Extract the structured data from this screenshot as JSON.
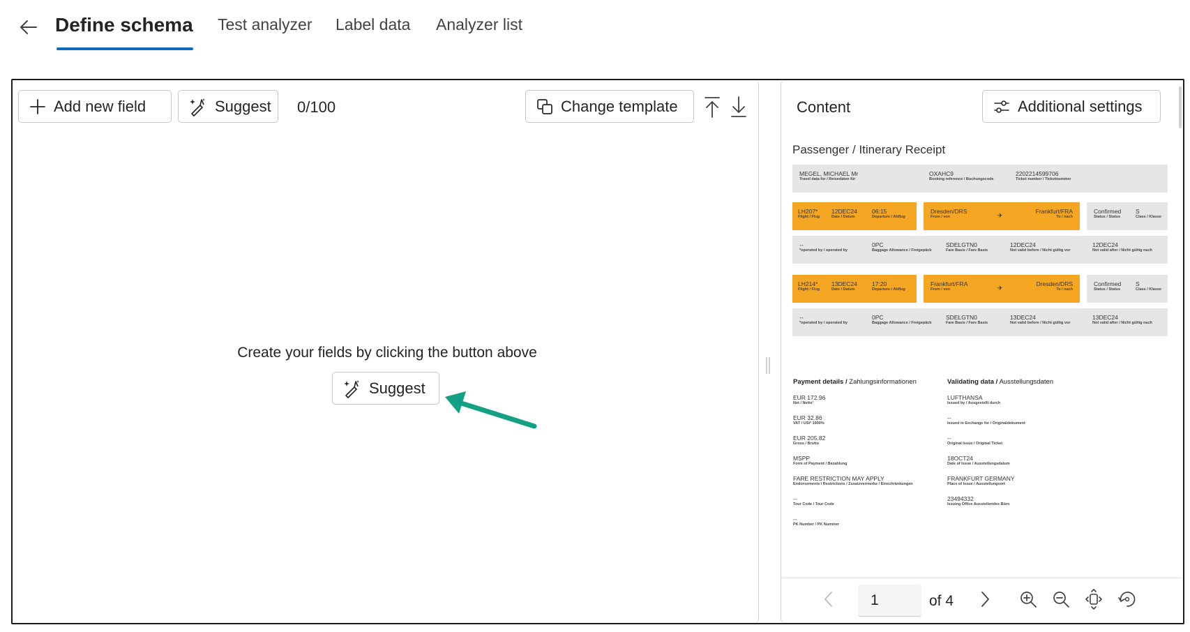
{
  "nav": {
    "tabs": [
      {
        "label": "Define schema",
        "active": true
      },
      {
        "label": "Test analyzer"
      },
      {
        "label": "Label data"
      },
      {
        "label": "Analyzer list"
      }
    ]
  },
  "toolbar": {
    "add_field_label": "Add new field",
    "suggest_label": "Suggest",
    "counter": "0/100",
    "change_template_label": "Change template"
  },
  "empty_state": {
    "message": "Create your fields by clicking the button above",
    "suggest_label": "Suggest"
  },
  "content_panel": {
    "title": "Content",
    "settings_label": "Additional settings"
  },
  "document": {
    "title": "Passenger / Itinerary Receipt",
    "header": {
      "name": "MEGEL, MICHAEL Mr",
      "name_label": "Travel data for / Reisedaten für",
      "booking": "OXAHC9",
      "booking_label": "Booking reference / Buchungscode",
      "ticket": "2202214599706",
      "ticket_label": "Ticket number / Ticketnummer"
    },
    "flights": [
      {
        "flight": "LH207*",
        "flight_label": "Flight / Flug",
        "date": "12DEC24",
        "date_label": "Date / Datum",
        "dep": "06:15",
        "dep_label": "Departure / Abflug",
        "from": "Dresden/DRS",
        "from_label": "From / von",
        "to": "Frankfurt/FRA",
        "to_label": "To / nach",
        "status": "Confirmed",
        "status_label": "Status / Status",
        "cls": "S",
        "cls_label": "Class / Klasse",
        "op": "--",
        "op_label": "*operated by / operated by",
        "bag": "0PC",
        "bag_label": "Baggage Allowance / Freigepäck",
        "fare": "SDELGTN0",
        "fare_label": "Fare Basis / Fare Basis",
        "nvb": "12DEC24",
        "nvb_label": "Not valid before / Nicht gültig vor",
        "nva": "12DEC24",
        "nva_label": "Not valid after / Nicht gültig nach"
      },
      {
        "flight": "LH214*",
        "flight_label": "Flight / Flug",
        "date": "13DEC24",
        "date_label": "Date / Datum",
        "dep": "17:20",
        "dep_label": "Departure / Abflug",
        "from": "Frankfurt/FRA",
        "from_label": "From / von",
        "to": "Dresden/DRS",
        "to_label": "To / nach",
        "status": "Confirmed",
        "status_label": "Status / Status",
        "cls": "S",
        "cls_label": "Class / Klasse",
        "op": "--",
        "op_label": "*operated by / operated by",
        "bag": "0PC",
        "bag_label": "Baggage Allowance / Freigepäck",
        "fare": "SDELGTN0",
        "fare_label": "Fare Basis / Fare Basis",
        "nvb": "13DEC24",
        "nvb_label": "Not valid before / Nicht gültig vor",
        "nva": "13DEC24",
        "nva_label": "Not valid after / Nicht gültig nach"
      }
    ],
    "payment": {
      "heading_bold": "Payment details /",
      "heading_rest": " Zahlungsinformationen",
      "items": [
        {
          "value": "EUR 172.96",
          "label": "Net / Netto¹"
        },
        {
          "value": "EUR 32.86",
          "label": "VAT / USt² 1900%"
        },
        {
          "value": "EUR 205.82",
          "label": "Gross / Brutto"
        },
        {
          "value": "MSPP",
          "label": "Form of Payment / Bezahlung"
        },
        {
          "value": "FARE RESTRICTION MAY APPLY",
          "label": "Endorsements / Restrictions / Zusatzvermerke / Einschränkungen"
        },
        {
          "value": "--",
          "label": "Tour Code / Tour Code"
        },
        {
          "value": "--",
          "label": "PK Number / PK Nummer"
        }
      ]
    },
    "validating": {
      "heading_bold": "Validating data /",
      "heading_rest": " Ausstellungsdaten",
      "items": [
        {
          "value": "LUFTHANSA",
          "label": "Issued by / Ausgestellt durch"
        },
        {
          "value": "--",
          "label": "Issued in Exchange for / Originaldokument"
        },
        {
          "value": "--",
          "label": "Original Issue / Original Ticket"
        },
        {
          "value": "18OCT24",
          "label": "Date of Issue / Ausstellungsdatum"
        },
        {
          "value": "FRANKFURT GERMANY",
          "label": "Place of Issue / Ausstellungsort"
        },
        {
          "value": "23494332",
          "label": "Issuing Office Ausstellendes Büro"
        }
      ]
    }
  },
  "pagination": {
    "current_page": "1",
    "of_label": "of 4"
  },
  "colors": {
    "accent": "#0f6cbd",
    "annotation_arrow": "#14a085",
    "doc_highlight": "#f5a623"
  }
}
